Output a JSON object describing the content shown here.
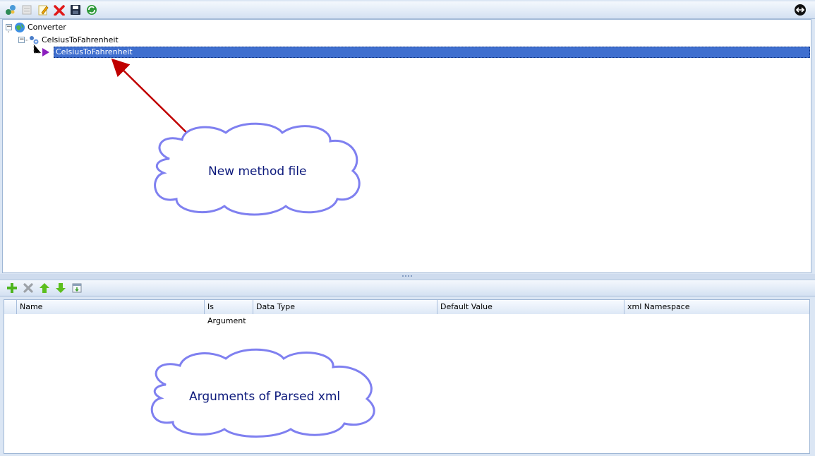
{
  "top_toolbar": {
    "icons": [
      "add-service-icon",
      "properties-icon",
      "edit-icon",
      "delete-icon",
      "save-icon",
      "refresh-icon"
    ],
    "right_icon": "back-arrow-icon"
  },
  "tree": {
    "root": "Converter",
    "child": "CelsiusToFahrenheit",
    "selected_method": "CelsiusToFahrenheit"
  },
  "bottom_toolbar": {
    "icons": [
      "add-icon",
      "remove-icon",
      "move-up-icon",
      "move-down-icon",
      "import-icon"
    ]
  },
  "grid": {
    "columns": [
      "Name",
      "Is Argument",
      "Data Type",
      "Default Value",
      "xml Namespace"
    ]
  },
  "annotations": {
    "cloud1": "New method file",
    "cloud2": "Arguments of Parsed xml"
  },
  "colors": {
    "selection": "#3f6fcf",
    "arrow": "#c00000",
    "cloud_border": "#7f80f0",
    "cloud_text": "#0d1a7c"
  }
}
